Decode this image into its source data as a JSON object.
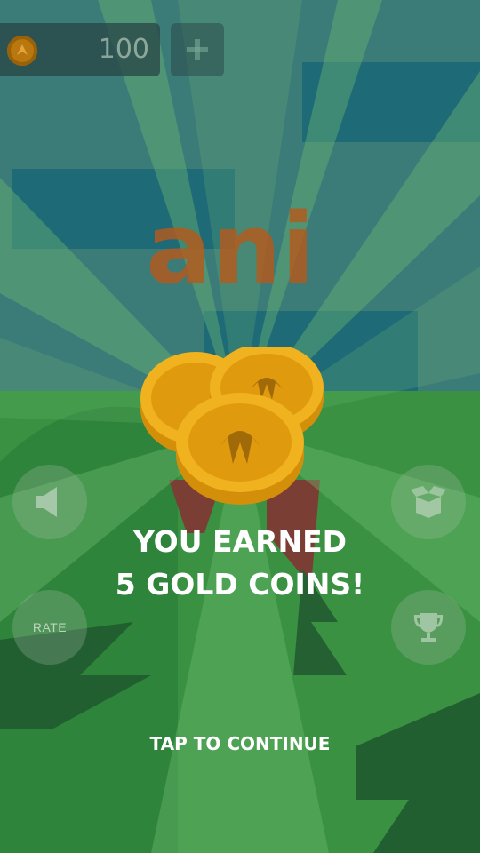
{
  "hud": {
    "coin_count": "100",
    "add_coins_icon": "plus-icon",
    "coin_icon": "coin-icon"
  },
  "title_logo": {
    "text": "ani",
    "color": "#b8591a"
  },
  "reward": {
    "line1": "YOU EARNED",
    "line2": "5 GOLD COINS!",
    "coin_color": "#f0b21f",
    "coin_shadow": "#d48f0a"
  },
  "buttons": {
    "sound_icon": "speaker-icon",
    "rate_label": "RATE",
    "box_icon": "open-box-icon",
    "trophy_icon": "trophy-icon"
  },
  "footer": {
    "tap_label": "TAP TO CONTINUE"
  },
  "colors": {
    "sky": "#3e7f86",
    "ray": "#5fbf62",
    "grass": "#3f9d45",
    "dark_tree": "#1f5c2c"
  }
}
